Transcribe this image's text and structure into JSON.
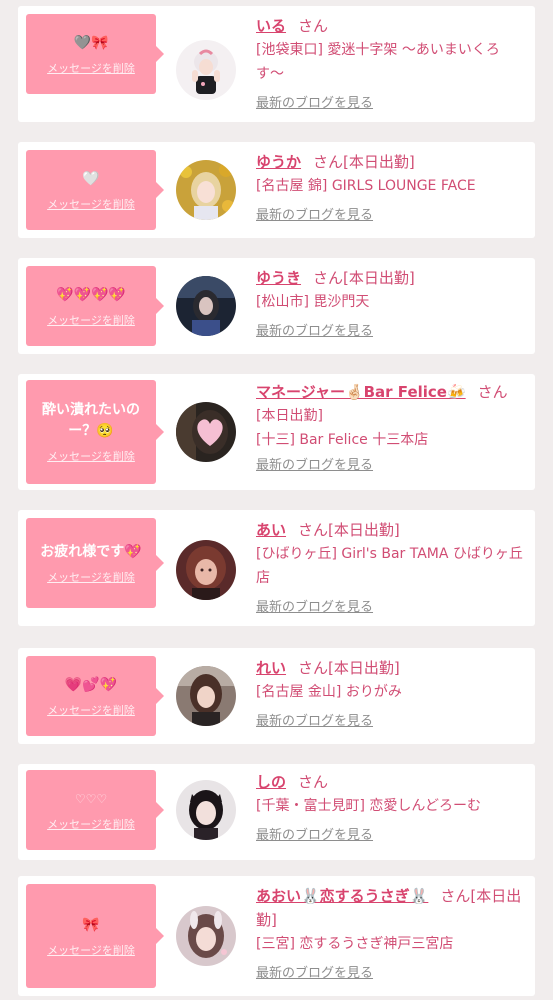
{
  "common": {
    "delete_label": "メッセージを削除",
    "blog_label": "最新のブログを見る",
    "honorific": "さん"
  },
  "colors": {
    "page_bg": "#f1eded",
    "bubble": "#ff9aae",
    "name": "#d8446e",
    "text": "#d14d74",
    "blog": "#8e8e8e"
  },
  "cards": [
    {
      "message": "🩶🎀",
      "name": "いる",
      "honor_status": "さん",
      "store": "[池袋東口] 愛迷十字架 〜あいまいくろす〜",
      "avatar": "avatar-1"
    },
    {
      "message": "🤍",
      "name": "ゆうか",
      "honor_status": "さん[本日出勤]",
      "store": "[名古屋 錦] GIRLS LOUNGE FACE",
      "avatar": "avatar-2"
    },
    {
      "message": "💖💖💖💖",
      "name": "ゆうき",
      "honor_status": "さん[本日出勤]",
      "store": "[松山市] 毘沙門天",
      "avatar": "avatar-3"
    },
    {
      "message": "酔い潰れたいのー？🥺",
      "name": "マネージャー🤞🏻Bar Felice🍻",
      "honor_status": "さん",
      "store_lines": [
        "[本日出勤]",
        "[十三] Bar Felice 十三本店"
      ],
      "avatar": "avatar-4"
    },
    {
      "message": "お疲れ様です💖",
      "name": "あい",
      "honor_status": "さん[本日出勤]",
      "store": "[ひばりヶ丘] Girl's Bar TAMA ひばりヶ丘店",
      "avatar": "avatar-5"
    },
    {
      "message": "💗💕💖",
      "name": "れい",
      "honor_status": "さん[本日出勤]",
      "store": "[名古屋 金山] おりがみ",
      "avatar": "avatar-6"
    },
    {
      "message": "♡♡♡",
      "name": "しの",
      "honor_status": "さん",
      "store": "[千葉・富士見町] 恋愛しんどろーむ",
      "avatar": "avatar-7"
    },
    {
      "message": "🎀",
      "name": "あおい🐰恋するうさぎ🐰",
      "honor_status": "さん[本日出勤]",
      "store": "[三宮] 恋するうさぎ神戸三宮店",
      "avatar": "avatar-8"
    }
  ]
}
